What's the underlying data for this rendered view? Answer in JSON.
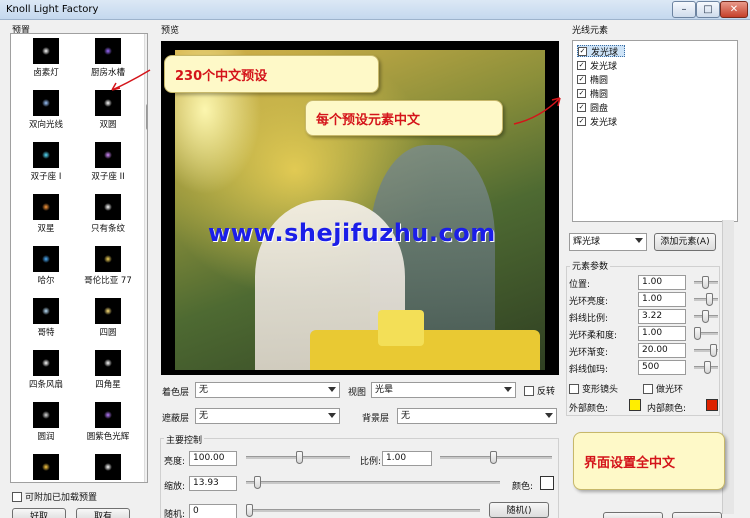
{
  "window": {
    "title": "Knoll Light Factory",
    "minimize": "–",
    "maximize": "□",
    "close": "✕"
  },
  "left": {
    "label": "预置",
    "presets": [
      {
        "name": "卤素灯",
        "color": "#ffffff"
      },
      {
        "name": "厨房水槽",
        "color": "#9b6bff"
      },
      {
        "name": "双向光线",
        "color": "#9ec7ff"
      },
      {
        "name": "双圆",
        "color": "#ffffff"
      },
      {
        "name": "双子座 I",
        "color": "#58e1ff"
      },
      {
        "name": "双子座 II",
        "color": "#d48bff"
      },
      {
        "name": "双星",
        "color": "#ff9a3c"
      },
      {
        "name": "只有条纹",
        "color": "#ffffff"
      },
      {
        "name": "哈尔",
        "color": "#4fb1ff"
      },
      {
        "name": "哥伦比亚 77",
        "color": "#f5d55a"
      },
      {
        "name": "哥特",
        "color": "#bfe4ff"
      },
      {
        "name": "四圆",
        "color": "#ffe37a"
      },
      {
        "name": "四条风扇",
        "color": "#ffffff"
      },
      {
        "name": "四角星",
        "color": "#ffffff"
      },
      {
        "name": "圆润",
        "color": "#dddddd"
      },
      {
        "name": "圆紫色光辉",
        "color": "#b97cff"
      },
      {
        "name": "",
        "color": "#ffcc44"
      },
      {
        "name": "",
        "color": "#ffffff"
      }
    ],
    "load_extra": "可附加已加载预置",
    "btn_ok": "好取",
    "btn_cancel": "取有"
  },
  "preview": {
    "label": "预览",
    "watermark": "www.shejifuzhu.com"
  },
  "callouts": {
    "c1": "230个中文预设",
    "c2": "每个预设元素中文",
    "c3": "界面设置全中文"
  },
  "controls": {
    "tint_label": "着色层",
    "tint_value": "无",
    "view_label": "视图",
    "view_value": "光晕",
    "invert_label": "反转",
    "mask_label": "遮蔽层",
    "mask_value": "无",
    "bg_label": "背景层",
    "bg_value": "无",
    "main_group": "主要控制",
    "brightness_label": "亮度:",
    "brightness_value": "100.00",
    "scale_label": "比例:",
    "scale_value": "1.00",
    "zoom_label": "缩放:",
    "zoom_value": "13.93",
    "color_label": "颜色:",
    "random_label": "随机:",
    "random_value": "0",
    "random_button": "随机()"
  },
  "right": {
    "label": "光线元素",
    "elements": [
      {
        "name": "发光球",
        "selected": true
      },
      {
        "name": "发光球",
        "selected": false
      },
      {
        "name": "椭圆",
        "selected": false
      },
      {
        "name": "椭圆",
        "selected": false
      },
      {
        "name": "圆盘",
        "selected": false
      },
      {
        "name": "发光球",
        "selected": false
      }
    ],
    "element_select": "辉光球",
    "add_element": "添加元素(A)",
    "params_group": "元素参数",
    "params": [
      {
        "label": "位置:",
        "value": "1.00"
      },
      {
        "label": "光环亮度:",
        "value": "1.00"
      },
      {
        "label": "斜线比例:",
        "value": "3.22"
      },
      {
        "label": "光环柔和度:",
        "value": "1.00"
      },
      {
        "label": "光环渐变:",
        "value": "20.00"
      },
      {
        "label": "斜线伽玛:",
        "value": "500"
      }
    ],
    "deform_label": "变形镜头",
    "halo_label": "做光环",
    "outer_color_label": "外部颜色:",
    "inner_color_label": "内部颜色:",
    "outer_color": "#ffee00",
    "inner_color": "#dd2200"
  },
  "colors": {
    "accent_red": "#d4141a",
    "callout_bg": "#fef9c8",
    "watermark_blue": "#1b1ee8"
  }
}
